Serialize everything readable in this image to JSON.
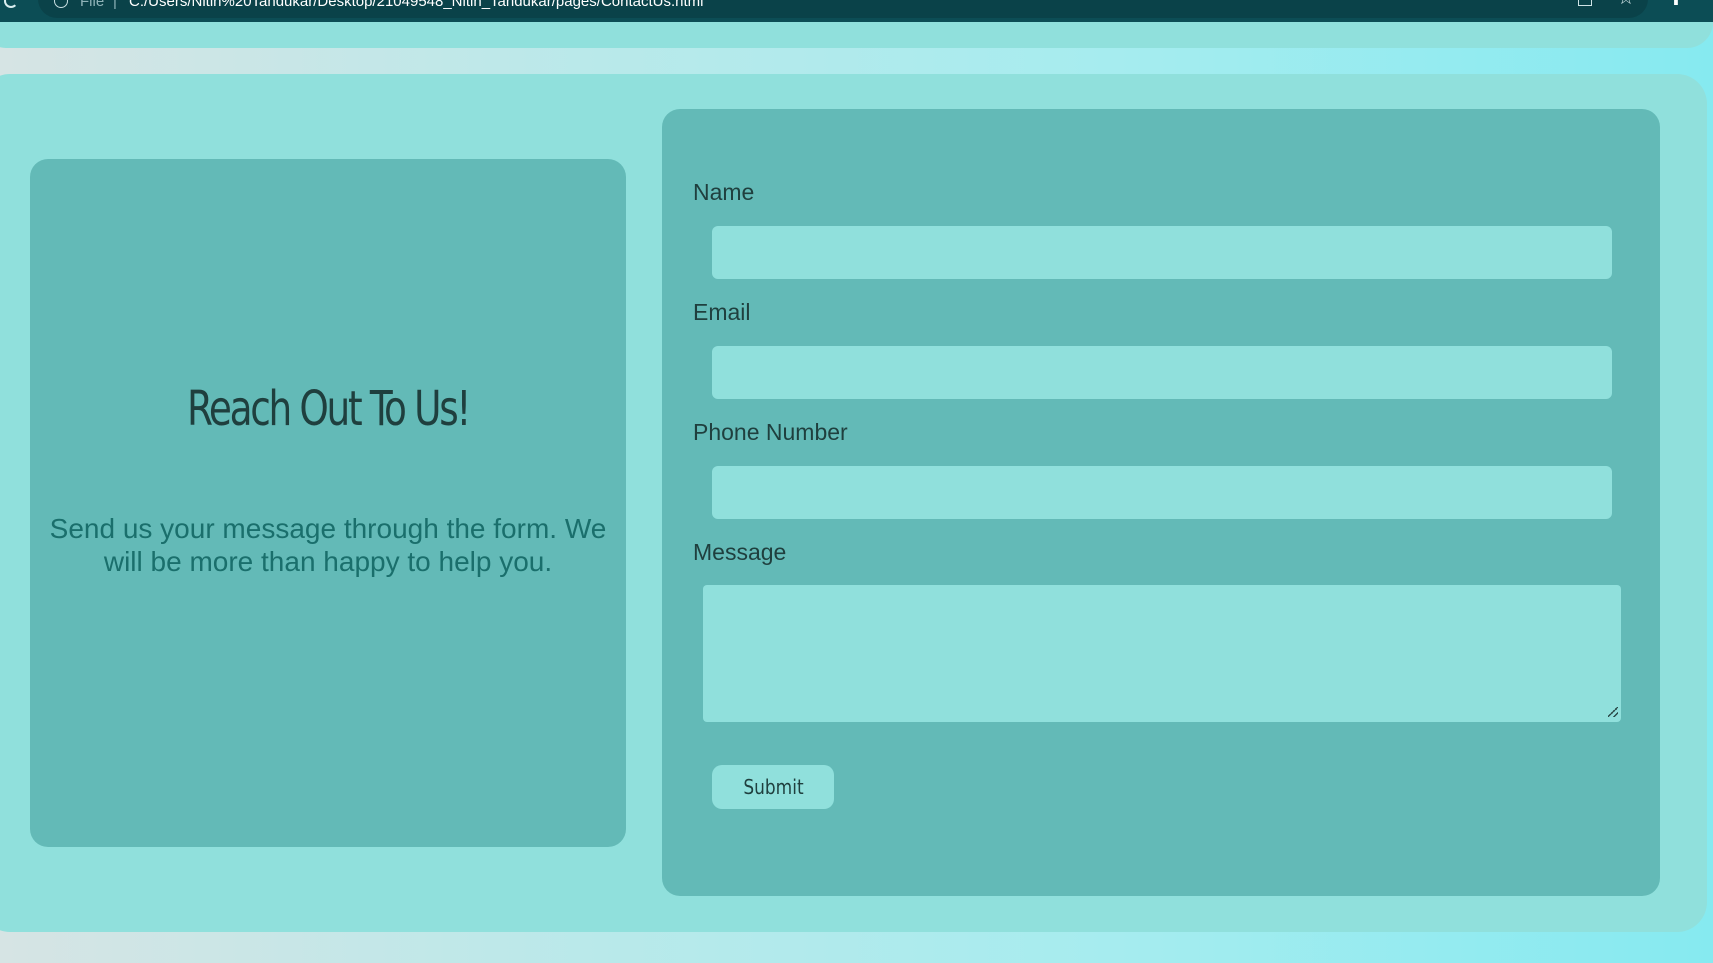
{
  "browser": {
    "url_scheme": "File",
    "url_separator": "|",
    "url": "C:/Users/Nitin%20Tandukar/Desktop/21049548_Nitin_Tandukar/pages/ContactUs.html"
  },
  "info_card": {
    "title": "Reach Out To Us!",
    "text": "Send us your message through the form. We will be more than happy to help you."
  },
  "form": {
    "name_label": "Name",
    "name_value": "",
    "email_label": "Email",
    "email_value": "",
    "phone_label": "Phone Number",
    "phone_value": "",
    "message_label": "Message",
    "message_value": "",
    "submit_label": "Submit"
  },
  "icons": [
    "reload-icon",
    "info-icon",
    "share-icon",
    "star-icon",
    "extensions-icon"
  ],
  "colors": {
    "browser_bar": "#0c4d55",
    "panel": "#90e0dc",
    "card": "#63bab7",
    "heading": "#1f3f3e",
    "info_text": "#1a6f6c"
  }
}
